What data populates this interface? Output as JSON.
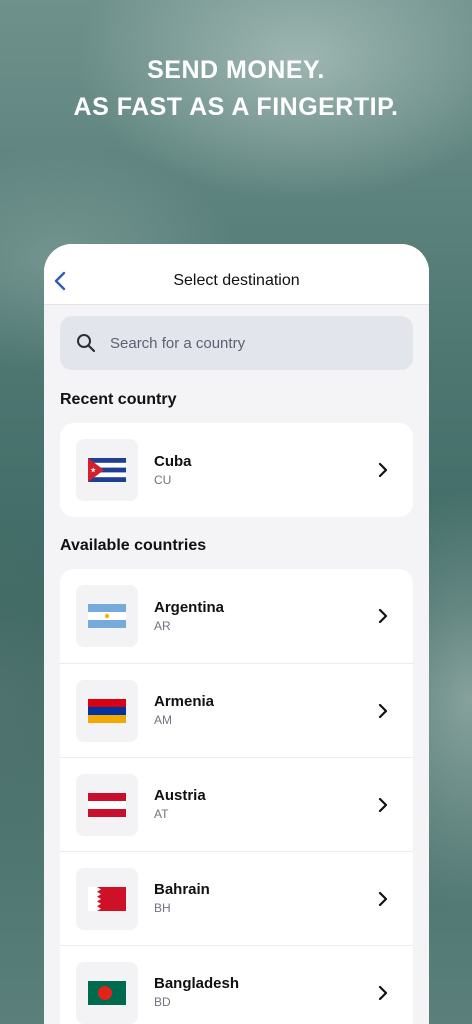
{
  "hero": {
    "line1": "SEND MONEY.",
    "line2": "AS FAST AS A FINGERTIP."
  },
  "header": {
    "title": "Select destination",
    "back_icon": "chevron-left-icon"
  },
  "search": {
    "placeholder": "Search for a country",
    "icon": "search-icon"
  },
  "recent": {
    "heading": "Recent country",
    "items": [
      {
        "name": "Cuba",
        "code": "CU",
        "flag": "cuba-flag-icon"
      }
    ]
  },
  "available": {
    "heading": "Available countries",
    "items": [
      {
        "name": "Argentina",
        "code": "AR",
        "flag": "argentina-flag-icon"
      },
      {
        "name": "Armenia",
        "code": "AM",
        "flag": "armenia-flag-icon"
      },
      {
        "name": "Austria",
        "code": "AT",
        "flag": "austria-flag-icon"
      },
      {
        "name": "Bahrain",
        "code": "BH",
        "flag": "bahrain-flag-icon"
      },
      {
        "name": "Bangladesh",
        "code": "BD",
        "flag": "bangladesh-flag-icon"
      }
    ]
  },
  "colors": {
    "accent": "#2f5db0",
    "card_bg": "#ffffff",
    "screen_bg": "#f4f4f6",
    "search_bg": "#e2e5ec"
  }
}
